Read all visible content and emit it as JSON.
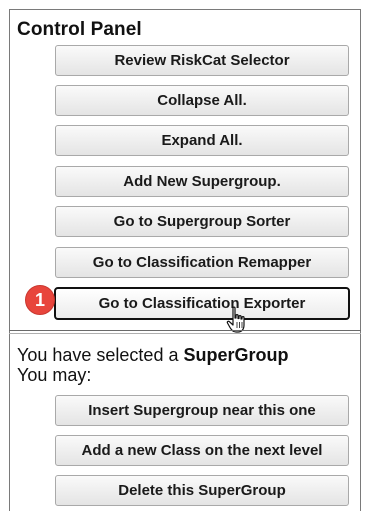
{
  "panel": {
    "title": "Control Panel",
    "buttons": [
      {
        "label": "Review RiskCat Selector"
      },
      {
        "label": "Collapse All."
      },
      {
        "label": "Expand All."
      },
      {
        "label": "Add New Supergroup."
      },
      {
        "label": "Go to Supergroup Sorter"
      },
      {
        "label": "Go to Classification Remapper"
      },
      {
        "label": "Go to Classification Exporter"
      }
    ]
  },
  "selection": {
    "text_prefix": "You have selected a ",
    "selected_type": "SuperGroup",
    "may_text": "You may:",
    "actions": [
      {
        "label": "Insert Supergroup near this one"
      },
      {
        "label": "Add a new Class on the next level"
      },
      {
        "label": "Delete this SuperGroup"
      }
    ]
  },
  "annotation": {
    "step_number": "1",
    "badge_color": "#e8453c"
  },
  "icons": {
    "cursor": "hand-pointer-icon"
  }
}
